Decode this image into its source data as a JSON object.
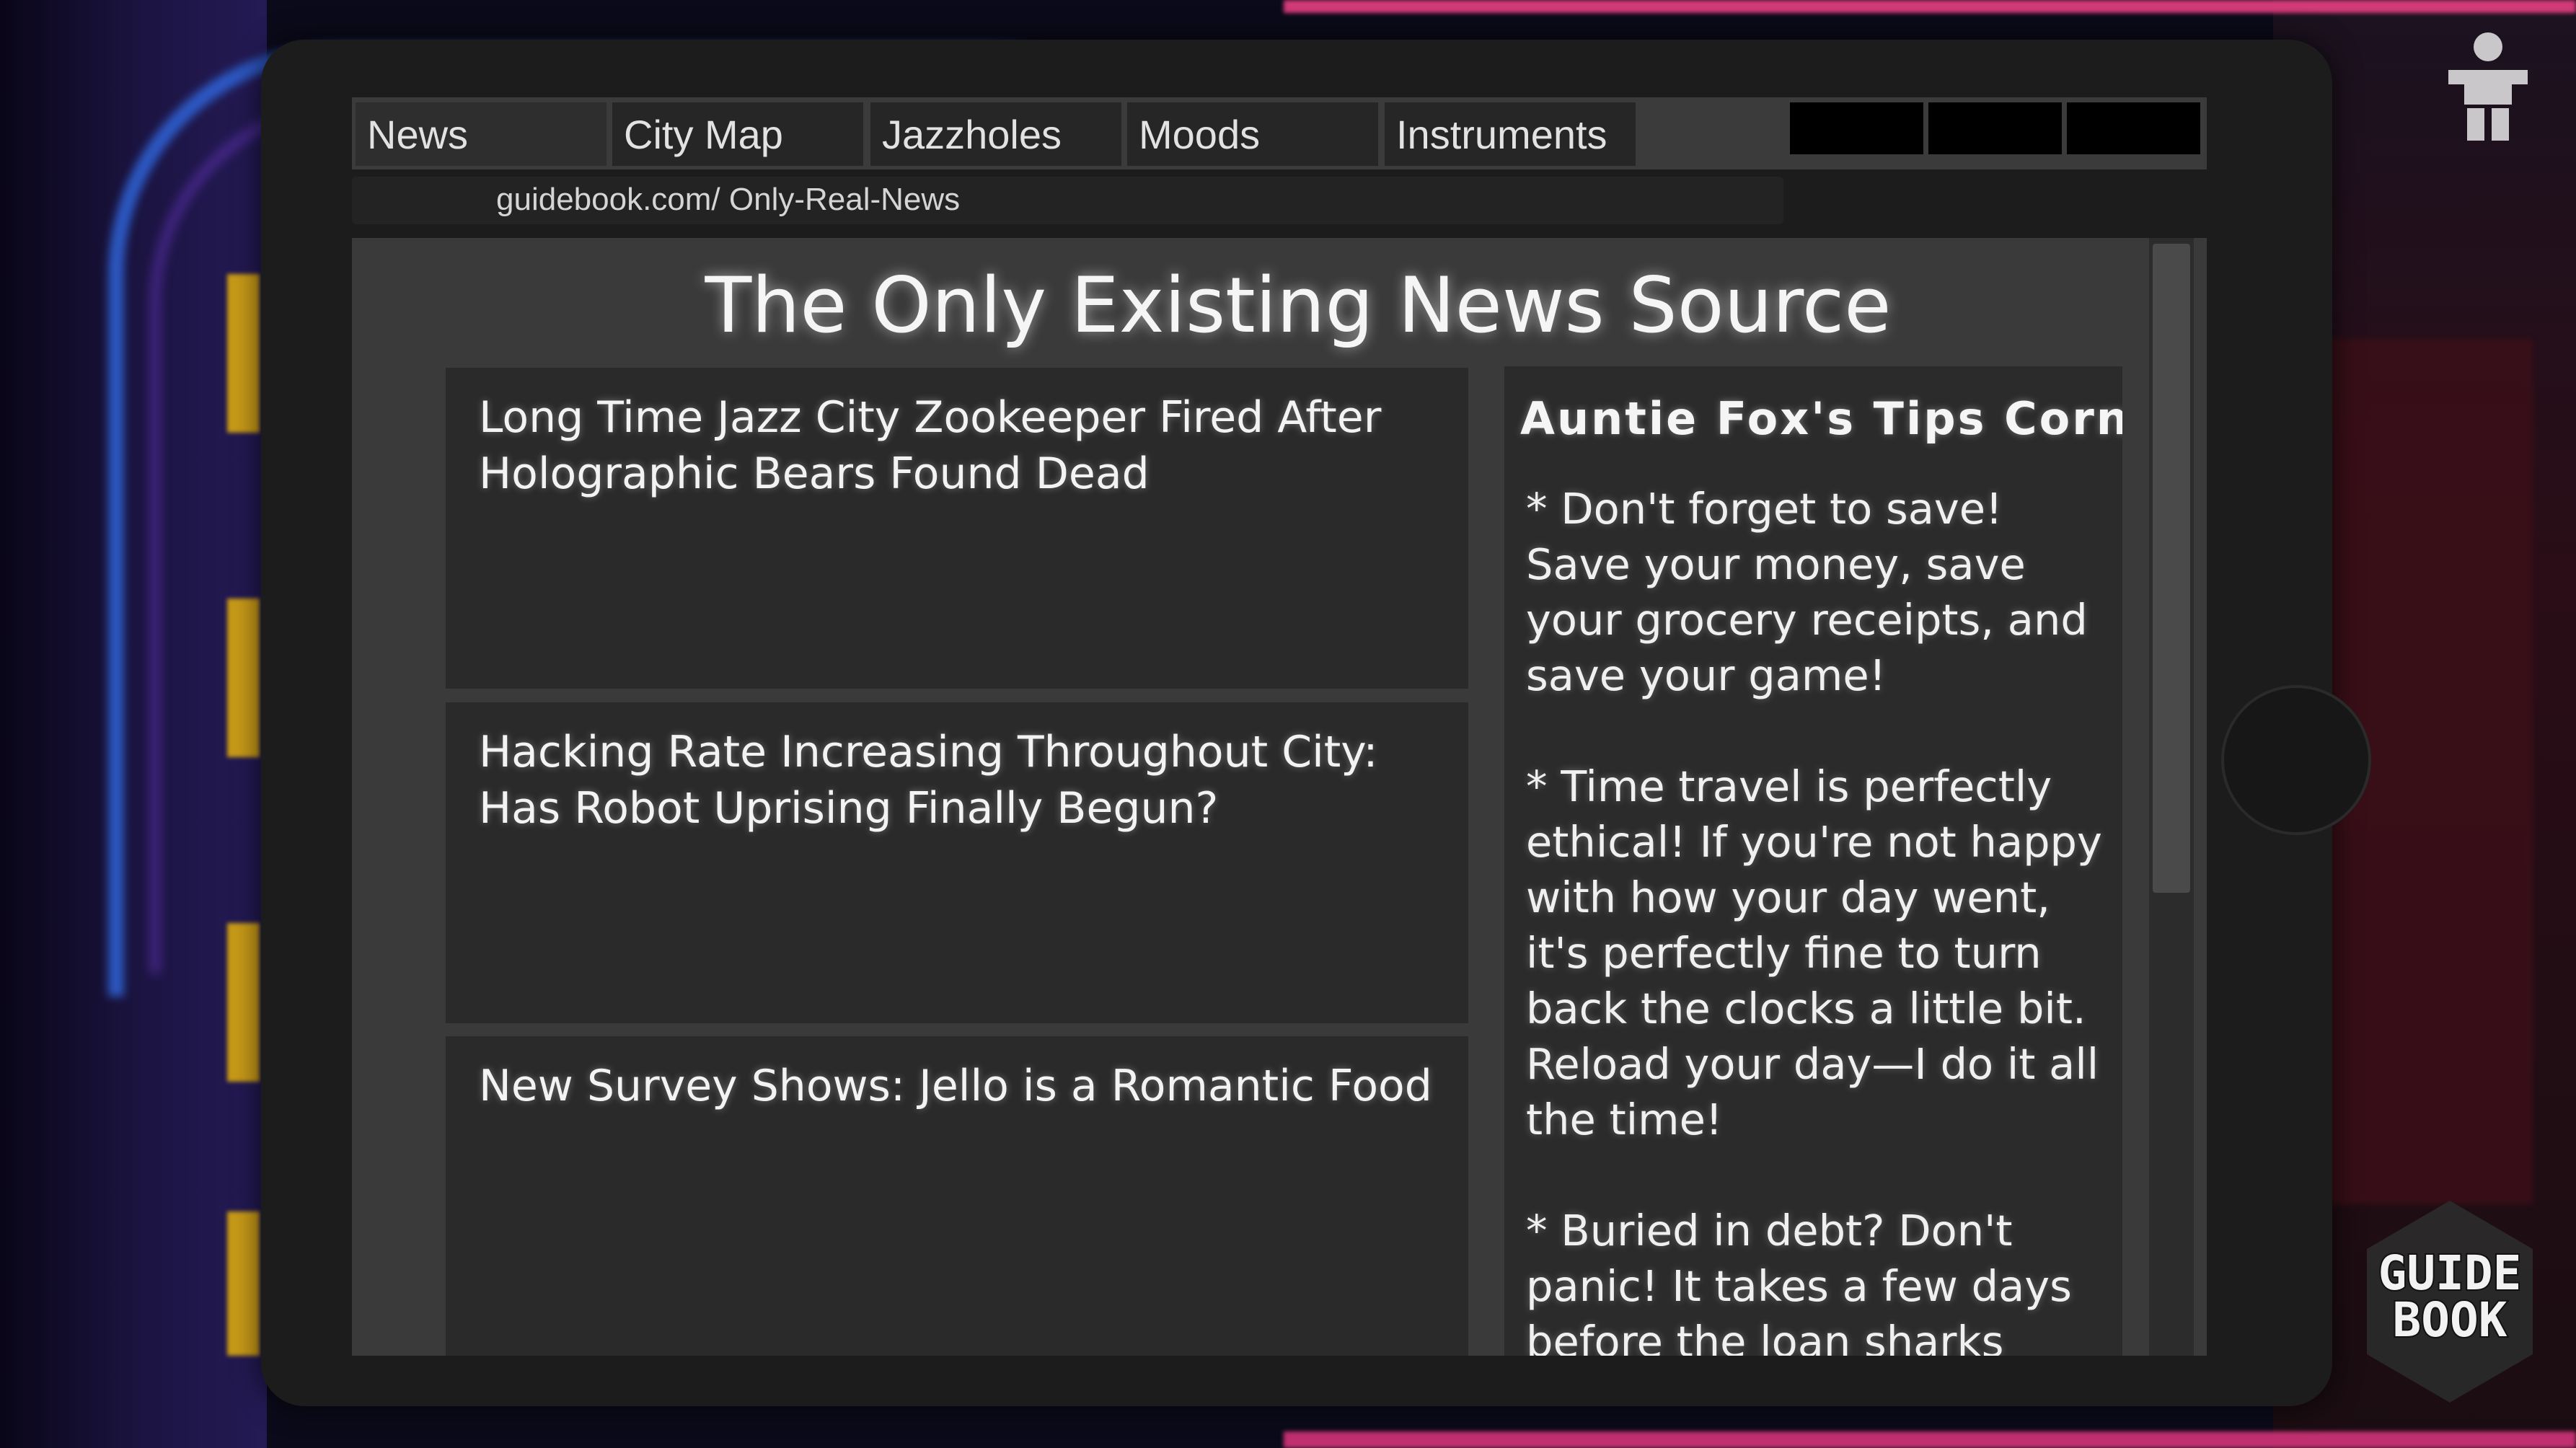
{
  "browser": {
    "tabs": [
      {
        "label": "News",
        "active": true
      },
      {
        "label": "City Map"
      },
      {
        "label": "Jazzholes"
      },
      {
        "label": "Moods"
      },
      {
        "label": "Instruments"
      }
    ],
    "url": "guidebook.com/ Only-Real-News"
  },
  "page": {
    "title": "The Only Existing News Source",
    "articles": [
      {
        "headline": "Long Time Jazz City Zookeeper Fired After Holographic Bears Found Dead"
      },
      {
        "headline": "Hacking Rate Increasing Throughout City: Has Robot Uprising Finally Begun?"
      },
      {
        "headline": "New Survey Shows: Jello is a Romantic Food"
      }
    ],
    "tips": {
      "title": "Auntie Fox's Tips Corner",
      "items": [
        "* Don't forget to save! Save your money, save your grocery receipts, and save your game!",
        "* Time travel is perfectly ethical! If you're not happy with how your day went, it's perfectly fine to turn back the clocks a little bit. Reload your day—I do it all the time!",
        "* Buried in debt? Don't panic! It takes a few days before the loan sharks"
      ]
    }
  },
  "hud": {
    "guide_book_label": [
      "GUIDE",
      "BOOK"
    ],
    "icons": [
      "person-icon",
      "guide-book-icon"
    ]
  },
  "colors": {
    "tablet": "#1c1c1c",
    "page_bg": "#3a3a3a",
    "card_bg": "#2a2a2a",
    "text": "#f3f3f3"
  }
}
